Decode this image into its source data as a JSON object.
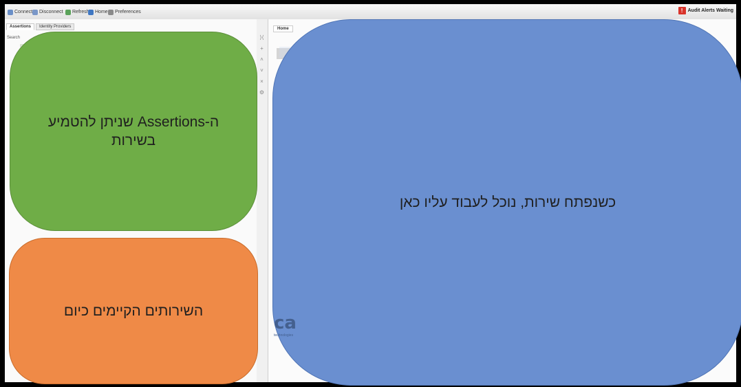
{
  "toolbar": {
    "items": [
      "Connect",
      "Disconnect",
      "Refresh",
      "Home",
      "Preferences"
    ],
    "right_label": "Audit Alerts Waiting"
  },
  "left_panel": {
    "tabs": [
      "Assertions",
      "Identity Providers"
    ],
    "search_label": "Search"
  },
  "main": {
    "tab_label": "Home"
  },
  "annotations": {
    "assertions_line1": "ה-Assertions שניתן להטמיע",
    "assertions_line2": "בשירות",
    "services": "השירותים הקיימים כיום",
    "workspace": "כשנפתח שירות, נוכל לעבוד עליו כאן"
  },
  "logo": {
    "text": "ca",
    "sub": "technologies"
  },
  "colors": {
    "green": "#6fad47",
    "orange": "#ef8a47",
    "blue": "#6a8fd0"
  }
}
